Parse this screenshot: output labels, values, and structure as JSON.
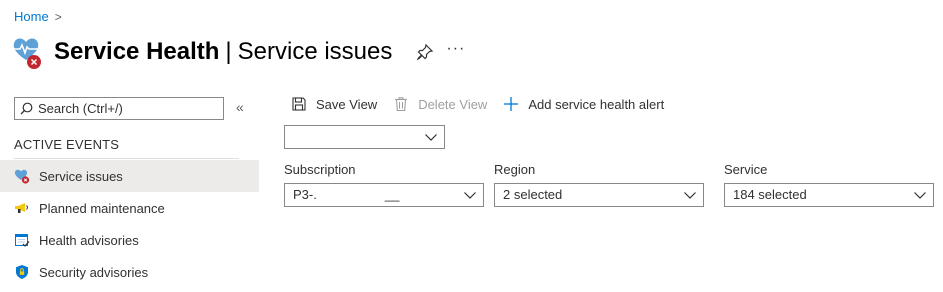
{
  "breadcrumb": {
    "home": "Home",
    "separator": ">"
  },
  "header": {
    "title_strong": "Service Health",
    "separator": "|",
    "title_sub": "Service issues",
    "more": "···"
  },
  "search": {
    "placeholder": "Search (Ctrl+/)",
    "value": ""
  },
  "sidebar": {
    "collapse_glyph": "«",
    "section_heading": "ACTIVE EVENTS",
    "items": [
      {
        "label": "Service issues",
        "icon": "service-issues-icon",
        "active": true
      },
      {
        "label": "Planned maintenance",
        "icon": "megaphone-icon",
        "active": false
      },
      {
        "label": "Health advisories",
        "icon": "calendar-check-icon",
        "active": false
      },
      {
        "label": "Security advisories",
        "icon": "shield-icon",
        "active": false
      }
    ]
  },
  "toolbar": {
    "save_view": "Save View",
    "delete_view": "Delete View",
    "add_alert": "Add service health alert"
  },
  "view_select": {
    "value": ""
  },
  "filters": {
    "subscription": {
      "label": "Subscription",
      "value": "P3-.",
      "masked_tail": "__"
    },
    "region": {
      "label": "Region",
      "value": "2 selected"
    },
    "service": {
      "label": "Service",
      "value": "184 selected"
    }
  },
  "colors": {
    "accent": "#0078d4",
    "error": "#c4262e",
    "active_bg": "#edebe9",
    "border": "#8a8886"
  }
}
